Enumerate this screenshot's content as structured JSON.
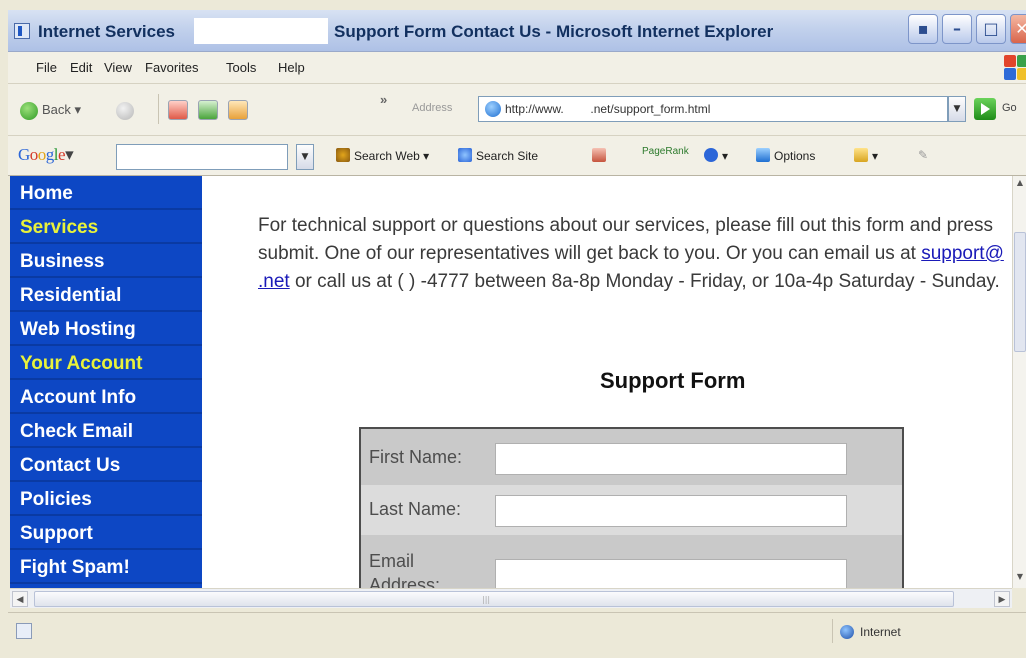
{
  "window": {
    "title_left": "Internet Services",
    "title_main": "Support Form Contact Us - Microsoft Internet Explorer"
  },
  "menu": [
    "File",
    "Edit",
    "View",
    "Favorites",
    "Tools",
    "Help"
  ],
  "nav": {
    "back_label": "Back",
    "address_label": "Address",
    "address_url": "http://www.        .net/support_form.html",
    "go_label": "Go"
  },
  "google_toolbar": {
    "logo": "Google",
    "search_value": "",
    "search_web": "Search Web",
    "search_site": "Search Site",
    "pagerank": "PageRank",
    "options": "Options"
  },
  "sidebar": {
    "items": [
      {
        "label": "Home",
        "section": false
      },
      {
        "label": "Services",
        "section": true
      },
      {
        "label": "Business",
        "section": false
      },
      {
        "label": "Residential",
        "section": false
      },
      {
        "label": "Web Hosting",
        "section": false
      },
      {
        "label": "Your Account",
        "section": true
      },
      {
        "label": "Account Info",
        "section": false
      },
      {
        "label": "Check Email",
        "section": false
      },
      {
        "label": "Contact Us",
        "section": false
      },
      {
        "label": "Policies",
        "section": false
      },
      {
        "label": "Support",
        "section": false
      },
      {
        "label": "Fight Spam!",
        "section": false
      }
    ]
  },
  "main": {
    "intro_1": "For technical support or questions about our services, please fill out this form and press submit. One of our representatives will get back to you. Or you can email us at ",
    "email_link": "support@          .net",
    "intro_2": " or call us at (       )     -4777 between 8a-8p Monday - Friday, or 10a-4p Saturday - Sunday.",
    "form_title": "Support Form",
    "fields": [
      {
        "label": "First Name:",
        "value": ""
      },
      {
        "label": "Last Name:",
        "value": ""
      },
      {
        "label": "Email Address:",
        "value": ""
      }
    ]
  },
  "status": {
    "zone": "Internet"
  },
  "colors": {
    "sidebar_bg": "#0d47c4",
    "sidebar_section": "#e9f23a",
    "link": "#1a1ab8"
  }
}
